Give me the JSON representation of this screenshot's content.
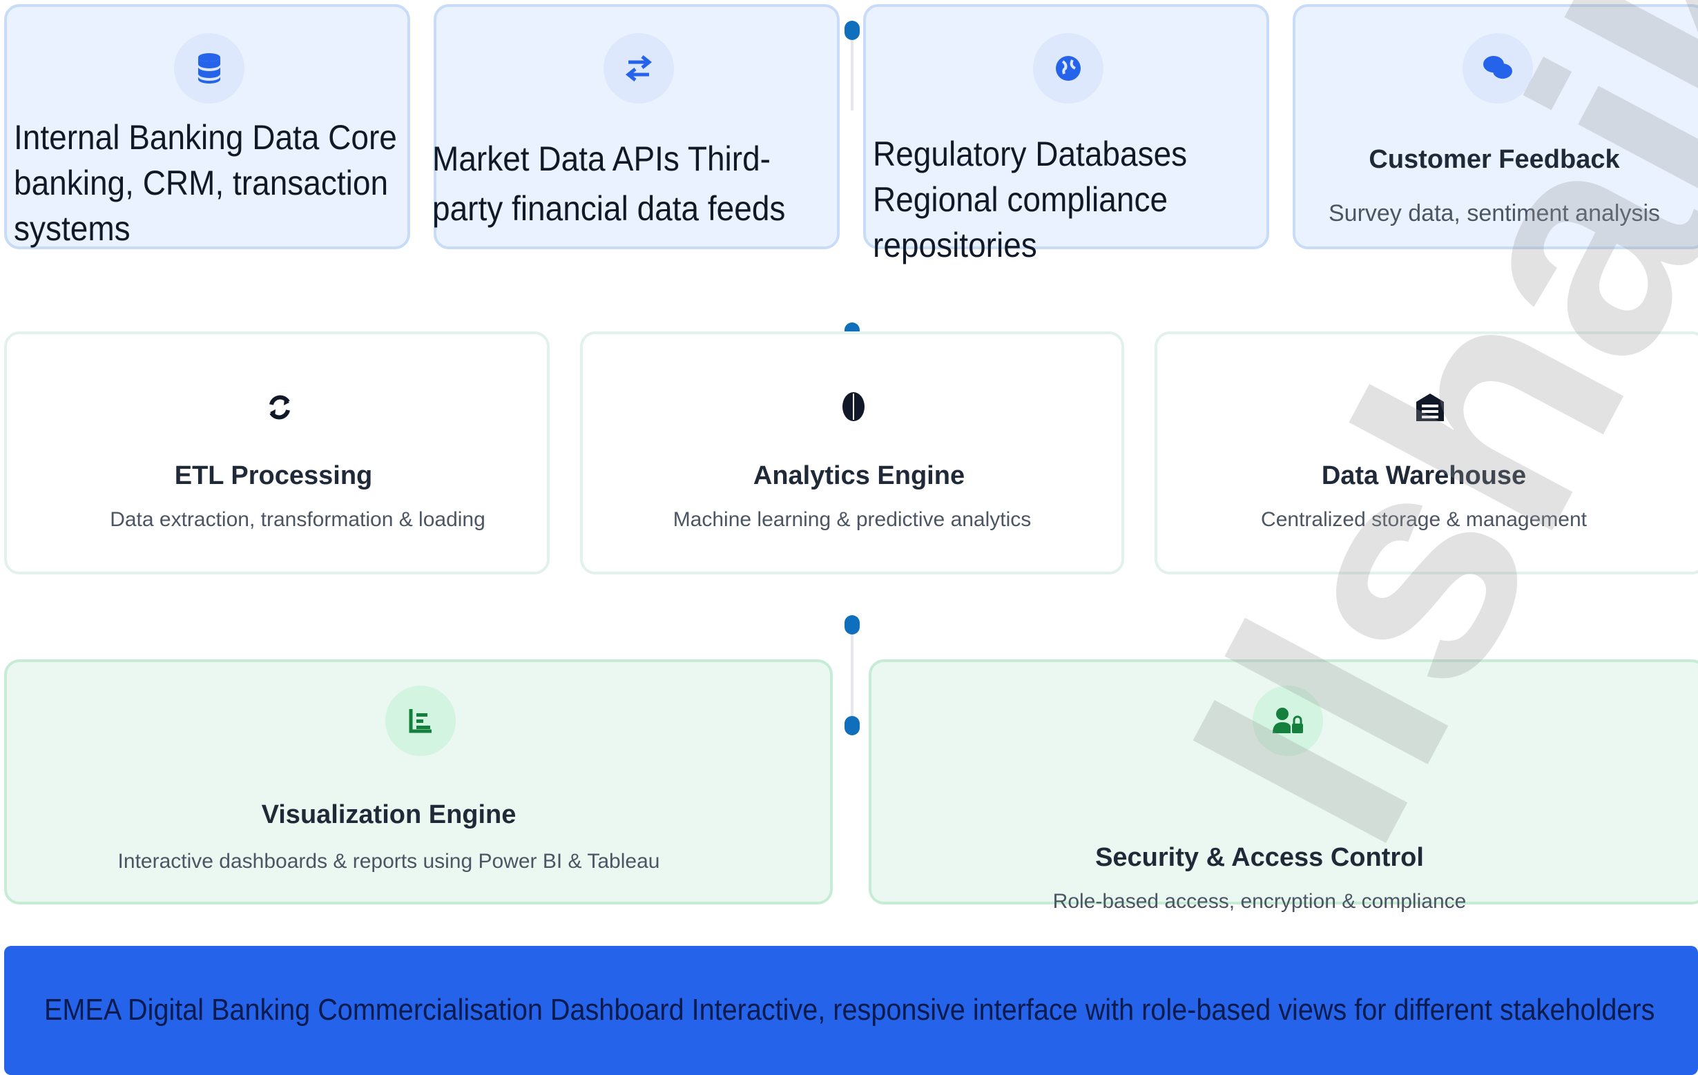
{
  "sources": [
    {
      "icon": "database-icon",
      "text": "Internal Banking Data Core banking, CRM, transaction systems"
    },
    {
      "icon": "exchange-arrows-icon",
      "text": "Market Data APIs Third-party financial data feeds"
    },
    {
      "icon": "globe-icon",
      "text": "Regulatory Databases Regional compliance repositories"
    },
    {
      "icon": "comments-icon",
      "title": "Customer Feedback",
      "desc": "Survey data, sentiment analysis"
    }
  ],
  "processing": [
    {
      "icon": "sync-icon",
      "title": "ETL Processing",
      "desc": "Data extraction, transformation & loading"
    },
    {
      "icon": "brain-icon",
      "title": "Analytics Engine",
      "desc": "Machine learning & predictive analytics"
    },
    {
      "icon": "warehouse-icon",
      "title": "Data Warehouse",
      "desc": "Centralized storage & management"
    }
  ],
  "outputs": [
    {
      "icon": "chart-icon",
      "title": "Visualization Engine",
      "desc": "Interactive dashboards & reports using Power BI & Tableau"
    },
    {
      "icon": "user-lock-icon",
      "title": "Security & Access Control",
      "desc": "Role-based access, encryption & compliance"
    }
  ],
  "banner": {
    "text": "EMEA Digital Banking Commercialisation Dashboard Interactive, responsive interface with role-based views for different stakeholders"
  },
  "watermark": {
    "text": "Ilshaikh"
  },
  "colors": {
    "accent_blue": "#2563eb",
    "connector_dot": "#0f6fbd",
    "source_bg": "#e9f2fe",
    "output_bg": "#ebf8f1"
  }
}
